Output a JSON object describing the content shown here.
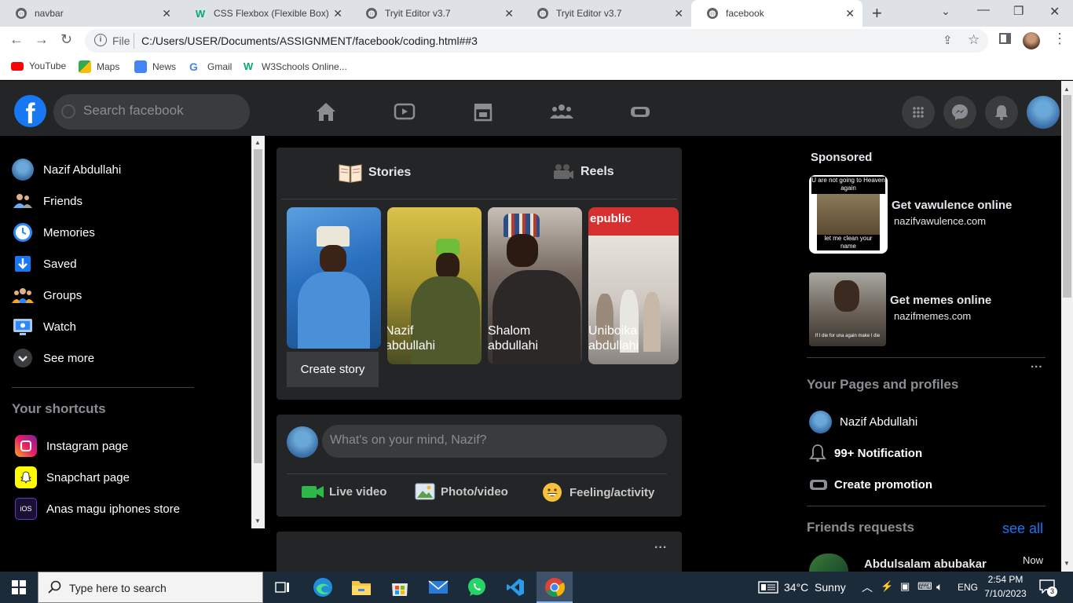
{
  "browser": {
    "tabs": [
      {
        "title": "navbar"
      },
      {
        "title": "CSS Flexbox (Flexible Box)"
      },
      {
        "title": "Tryit Editor v3.7"
      },
      {
        "title": "Tryit Editor v3.7"
      },
      {
        "title": "facebook"
      }
    ],
    "new_tab": "+",
    "address_prefix": "File",
    "url": "C:/Users/USER/Documents/ASSIGNMENT/facebook/coding.html##3",
    "bookmarks": [
      "YouTube",
      "Maps",
      "News",
      "Gmail",
      "W3Schools Online..."
    ]
  },
  "fb": {
    "search_placeholder": "Search facebook",
    "logo_letter": "f",
    "sidebar": {
      "user": "Nazif Abdullahi",
      "items": [
        "Friends",
        "Memories",
        "Saved",
        "Groups",
        "Watch",
        "See more"
      ],
      "shortcuts_title": "Your shortcuts",
      "shortcuts": [
        "Instagram page",
        "Snapchart page",
        "Anas magu iphones store"
      ],
      "ios_label": "iOS"
    },
    "stories": {
      "tab_stories": "Stories",
      "tab_reels": "Reels",
      "create": "Create story",
      "items": [
        {
          "name": "Nazif abdullahi"
        },
        {
          "name": "Shalom abdullahi"
        },
        {
          "name": "Uniboika abdullahi"
        }
      ],
      "store_sign": "epublic"
    },
    "composer": {
      "placeholder": "What's on your mind, Nazif?",
      "actions": [
        "Live video",
        "Photo/video",
        "Feeling/activity"
      ]
    },
    "post_more": "...",
    "right": {
      "sponsored": "Sponsored",
      "ads": [
        {
          "title": "Get vawulence online",
          "site": "nazifvawulence.com",
          "caption_top": "U are not going to Heaven again",
          "caption_bottom": "let me clean your name"
        },
        {
          "title": "Get memes online",
          "site": "nazifmemes.com",
          "caption_bottom": "If I die for una again make I die"
        }
      ],
      "more": "...",
      "pages_title": "Your Pages and profiles",
      "pages": [
        "Nazif Abdullahi",
        "99+ Notification",
        "Create promotion"
      ],
      "requests_title": "Friends requests",
      "see_all": "see all",
      "request_name": "Abdulsalam abubakar",
      "request_time": "Now"
    }
  },
  "taskbar": {
    "search": "Type here to search",
    "weather": "34°C  Sunny",
    "lang": "ENG",
    "time": "2:54 PM",
    "date": "7/10/2023",
    "notif_count": "3"
  }
}
